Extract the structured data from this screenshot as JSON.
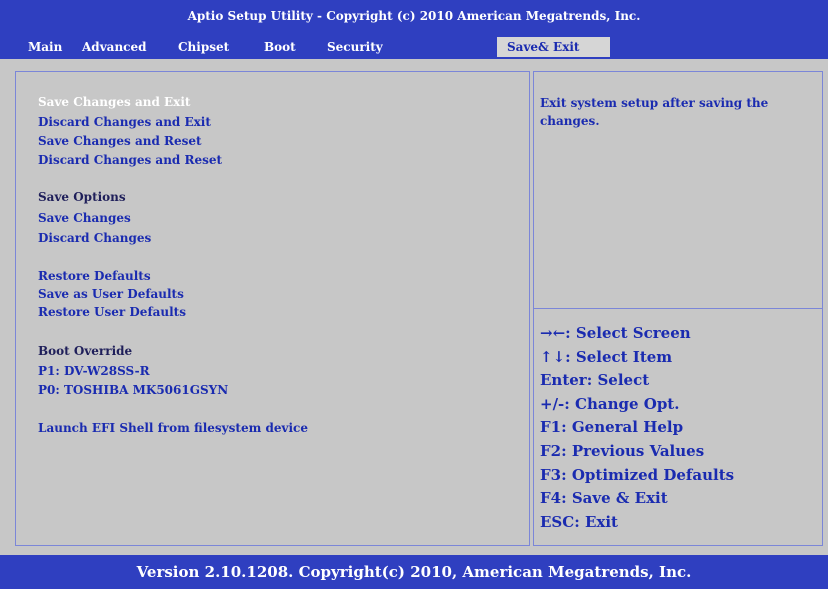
{
  "title": "Aptio Setup Utility - Copyright (c) 2010 American Megatrends, Inc.",
  "tabs": [
    {
      "label": "Main"
    },
    {
      "label": "Advanced"
    },
    {
      "label": "Chipset"
    },
    {
      "label": "Boot"
    },
    {
      "label": "Security"
    },
    {
      "label": "Save& Exit",
      "active": true
    }
  ],
  "menu": {
    "save_changes_and_exit": "Save Changes and Exit",
    "discard_changes_and_exit": "Discard Changes and Exit",
    "save_changes_and_reset": "Save Changes and Reset",
    "discard_changes_and_reset": "Discard Changes and Reset",
    "save_options_heading": "Save Options",
    "save_changes": "Save Changes",
    "discard_changes": "Discard Changes",
    "restore_defaults": "Restore Defaults",
    "save_as_user_defaults": "Save as User Defaults",
    "restore_user_defaults": "Restore User Defaults",
    "boot_override_heading": "Boot Override",
    "boot_p1": "P1: DV-W28SS-R",
    "boot_p0": "P0: TOSHIBA MK5061GSYN",
    "launch_efi_shell": "Launch EFI Shell from filesystem device"
  },
  "help_text": "Exit system setup after saving the changes.",
  "keys": [
    "→←: Select Screen",
    "↑↓: Select Item",
    "Enter: Select",
    "+/-: Change Opt.",
    "F1: General Help",
    "F2: Previous Values",
    "F3: Optimized Defaults",
    "F4: Save & Exit",
    "ESC: Exit"
  ],
  "footer": "Version 2.10.1208. Copyright(c) 2010, American Megatrends, Inc.",
  "colors": {
    "frame_blue": "#2f3fc0",
    "panel_gray": "#c7c7c7",
    "item_blue": "#1a2bb0",
    "highlight_text": "#ffffff"
  }
}
